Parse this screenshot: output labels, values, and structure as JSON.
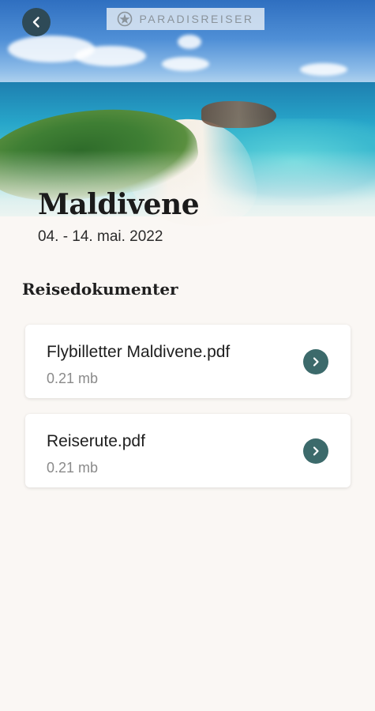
{
  "brand": {
    "name": "PARADISREISER"
  },
  "trip": {
    "destination": "Maldivene",
    "dates": "04. - 14. mai. 2022"
  },
  "documents_section": {
    "title": "Reisedokumenter",
    "items": [
      {
        "name": "Flybilletter Maldivene.pdf",
        "size": "0.21 mb"
      },
      {
        "name": "Reiserute.pdf",
        "size": "0.21 mb"
      }
    ]
  },
  "colors": {
    "back_button": "#2e4a57",
    "arrow_button": "#3c6a6b",
    "background": "#faf7f4"
  },
  "icons": {
    "back": "chevron-left-icon",
    "open": "chevron-right-icon",
    "logo": "compass-star-icon"
  }
}
